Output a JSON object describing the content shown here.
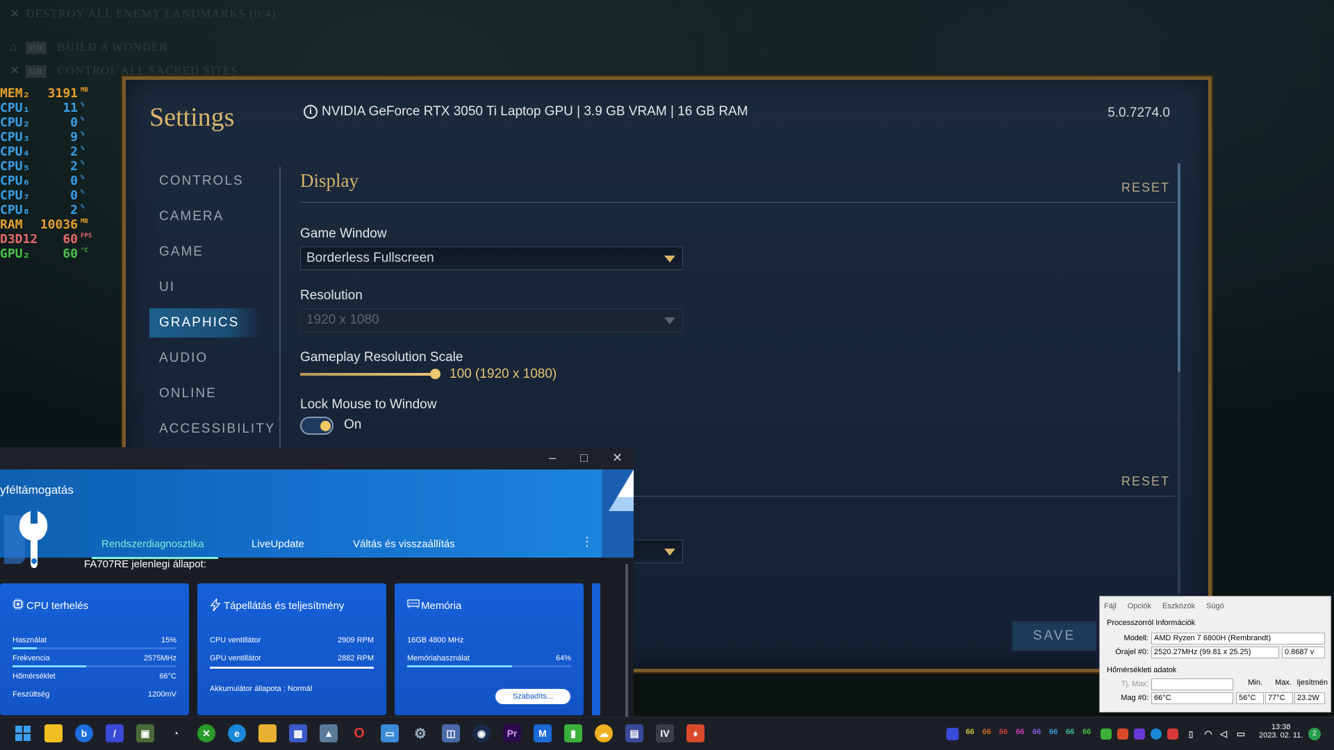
{
  "background": {
    "objectives": [
      {
        "text": "DESTROY ALL ENEMY LANDMARKS (0/4)",
        "badge": ""
      },
      {
        "text": "BUILD A WONDER",
        "badge": "OR"
      },
      {
        "text": "CONTROL ALL SACRED SITES",
        "badge": "OR"
      }
    ]
  },
  "osd": [
    {
      "label": "MEM₂",
      "value": "3191",
      "unit": "MB",
      "color": "#e8a02c"
    },
    {
      "label": "CPU₁",
      "value": "11",
      "unit": "%",
      "color": "#3aa0e8"
    },
    {
      "label": "CPU₂",
      "value": "0",
      "unit": "%",
      "color": "#3aa0e8"
    },
    {
      "label": "CPU₃",
      "value": "9",
      "unit": "%",
      "color": "#3aa0e8"
    },
    {
      "label": "CPU₄",
      "value": "2",
      "unit": "%",
      "color": "#3aa0e8"
    },
    {
      "label": "CPU₅",
      "value": "2",
      "unit": "%",
      "color": "#3aa0e8"
    },
    {
      "label": "CPU₆",
      "value": "0",
      "unit": "%",
      "color": "#3aa0e8"
    },
    {
      "label": "CPU₇",
      "value": "0",
      "unit": "%",
      "color": "#3aa0e8"
    },
    {
      "label": "CPU₈",
      "value": "2",
      "unit": "%",
      "color": "#3aa0e8"
    },
    {
      "label": "RAM",
      "value": "10036",
      "unit": "MB",
      "color": "#e8a02c"
    },
    {
      "label": "D3D12",
      "value": "60",
      "unit": "FPS",
      "color": "#e86a6a"
    },
    {
      "label": "GPU₂",
      "value": "60",
      "unit": "°C",
      "color": "#4ac24a"
    }
  ],
  "settings": {
    "title": "Settings",
    "hw_info": "NVIDIA GeForce RTX 3050 Ti Laptop GPU | 3.9 GB VRAM | 16 GB RAM",
    "version": "5.0.7274.0",
    "nav": [
      "CONTROLS",
      "CAMERA",
      "GAME",
      "UI",
      "GRAPHICS",
      "AUDIO",
      "ONLINE",
      "ACCESSIBILITY"
    ],
    "active_nav": "GRAPHICS",
    "section_title": "Display",
    "reset_label": "RESET",
    "game_window_label": "Game Window",
    "game_window_value": "Borderless Fullscreen",
    "resolution_label": "Resolution",
    "resolution_value": "1920 x 1080",
    "scale_label": "Gameplay Resolution Scale",
    "scale_value": "100",
    "scale_detail": "(1920 x 1080)",
    "lock_mouse_label": "Lock Mouse to Window",
    "lock_mouse_state": "On",
    "save_label": "SAVE",
    "accent_color": "#d8b46a"
  },
  "support_app": {
    "header_title": "yféltámogatás",
    "window_controls": [
      "–",
      "□",
      "✕"
    ],
    "tabs": [
      "Rendszerdiagnosztika",
      "LiveUpdate",
      "Váltás és visszaállítás"
    ],
    "active_tab": "Rendszerdiagnosztika",
    "status_label": "FA707RE jelenlegi állapot:",
    "cards": {
      "cpu": {
        "title": "CPU terhelés",
        "rows": [
          {
            "label": "Használat",
            "value": "15%"
          },
          {
            "label": "Frekvencia",
            "value": "2575MHz"
          },
          {
            "label": "Hőmérséklet",
            "value": "66°C"
          },
          {
            "label": "Feszültség",
            "value": "1200mV"
          }
        ],
        "usage_fraction": 0.15,
        "freq_fraction": 0.45
      },
      "power": {
        "title": "Tápellátás és teljesítmény",
        "rows": [
          {
            "label": "CPU ventillátor",
            "value": "2909 RPM"
          },
          {
            "label": "GPU ventillátor",
            "value": "2882 RPM"
          }
        ],
        "battery": "Akkumulátor állapota : Normál"
      },
      "memory": {
        "title": "Memória",
        "spec": "16GB 4800 MHz",
        "usage_label": "Memóriahasználat",
        "usage_value": "64%",
        "usage_fraction": 0.64,
        "button": "Szabadíts..."
      }
    }
  },
  "cpu_info": {
    "menu": [
      "Fájl",
      "Opciók",
      "Eszközök",
      "Súgó"
    ],
    "proc_group": "Processzorról Információk",
    "model_label": "Modell:",
    "model_value": "AMD Ryzen 7 6800H (Rembrandt)",
    "clock_label": "Órajel #0:",
    "clock_value": "2520.27MHz (99.81 x 25.25)",
    "voltage_value": "0.8687 v",
    "temp_group": "Hőmérsékleti adatok",
    "col_min": "Min.",
    "col_max": "Max.",
    "col_power": "Ijesítmén",
    "tjmax_label": "Tj. Max:",
    "core_label": "Mag #0:",
    "core_temp": "66°C",
    "core_min": "56°C",
    "core_max": "77°C",
    "core_power": "23.2W"
  },
  "taskbar": {
    "tray_numbers": [
      {
        "value": "66",
        "color": "#c8c840"
      },
      {
        "value": "66",
        "color": "#d06a2a"
      },
      {
        "value": "66",
        "color": "#d03a3a"
      },
      {
        "value": "66",
        "color": "#c83ab8"
      },
      {
        "value": "66",
        "color": "#8a5ae0"
      },
      {
        "value": "66",
        "color": "#3a9ae0"
      },
      {
        "value": "66",
        "color": "#3ac08a"
      },
      {
        "value": "66",
        "color": "#4ac04a"
      }
    ],
    "time": "13:38",
    "date": "2023. 02. 11.",
    "notification_count": "2"
  }
}
